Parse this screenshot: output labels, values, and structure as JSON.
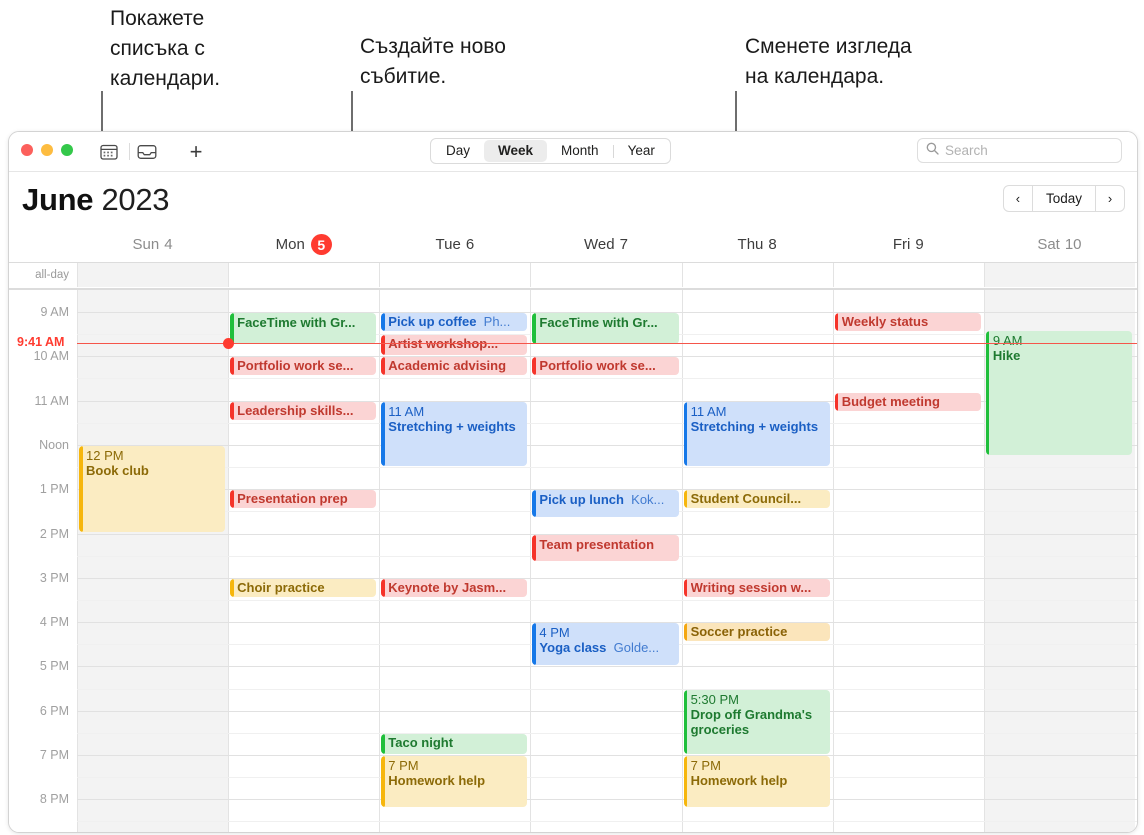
{
  "callouts": [
    {
      "text": "Покажете\nсписъка с\nкалендари."
    },
    {
      "text": "Създайте ново\nсъбитие."
    },
    {
      "text": "Сменете изгледа\nна календара."
    }
  ],
  "toolbar": {
    "calendars_icon": "calendar-list-icon",
    "inbox_icon": "inbox-icon",
    "add_label": "+",
    "views": [
      {
        "label": "Day",
        "active": false
      },
      {
        "label": "Week",
        "active": true
      },
      {
        "label": "Month",
        "active": false
      },
      {
        "label": "Year",
        "active": false
      }
    ],
    "search": {
      "placeholder": "Search",
      "value": "",
      "icon": "search-icon"
    }
  },
  "header": {
    "month": "June",
    "year": "2023",
    "prev_label": "‹",
    "today_label": "Today",
    "next_label": "›"
  },
  "grid": {
    "allday_label": "all-day",
    "now": {
      "label": "9:41 AM",
      "hour": 9.69
    },
    "hours": [
      {
        "label": "9 AM",
        "h": 9
      },
      {
        "label": "10 AM",
        "h": 10
      },
      {
        "label": "11 AM",
        "h": 11
      },
      {
        "label": "Noon",
        "h": 12
      },
      {
        "label": "1 PM",
        "h": 13
      },
      {
        "label": "2 PM",
        "h": 14
      },
      {
        "label": "3 PM",
        "h": 15
      },
      {
        "label": "4 PM",
        "h": 16
      },
      {
        "label": "5 PM",
        "h": 17
      },
      {
        "label": "6 PM",
        "h": 18
      },
      {
        "label": "7 PM",
        "h": 19
      },
      {
        "label": "8 PM",
        "h": 20
      }
    ],
    "days": [
      {
        "name": "Sun",
        "num": "4",
        "today": false,
        "weekend": true
      },
      {
        "name": "Mon",
        "num": "5",
        "today": true,
        "weekend": false
      },
      {
        "name": "Tue",
        "num": "6",
        "today": false,
        "weekend": false
      },
      {
        "name": "Wed",
        "num": "7",
        "today": false,
        "weekend": false
      },
      {
        "name": "Thu",
        "num": "8",
        "today": false,
        "weekend": false
      },
      {
        "name": "Fri",
        "num": "9",
        "today": false,
        "weekend": false
      },
      {
        "name": "Sat",
        "num": "10",
        "today": false,
        "weekend": true
      }
    ],
    "events": [
      {
        "day": 0,
        "start": 12,
        "end": 14,
        "title": "Book club",
        "time": "12 PM",
        "loc": "",
        "color": "yellow",
        "show_time": true
      },
      {
        "day": 1,
        "start": 9,
        "end": 9.75,
        "title": "FaceTime with Gr...",
        "time": "",
        "loc": "",
        "color": "green",
        "show_time": false
      },
      {
        "day": 1,
        "start": 10,
        "end": 10.45,
        "title": "Portfolio work se...",
        "time": "",
        "loc": "",
        "color": "red",
        "show_time": false
      },
      {
        "day": 1,
        "start": 11,
        "end": 11.45,
        "title": "Leadership skills...",
        "time": "",
        "loc": "",
        "color": "red",
        "show_time": false
      },
      {
        "day": 1,
        "start": 13,
        "end": 13.45,
        "title": "Presentation prep",
        "time": "",
        "loc": "",
        "color": "red",
        "show_time": false
      },
      {
        "day": 1,
        "start": 15,
        "end": 15.45,
        "title": "Choir practice",
        "time": "",
        "loc": "",
        "color": "yellow",
        "show_time": false
      },
      {
        "day": 2,
        "start": 9,
        "end": 9.45,
        "title": "Pick up coffee",
        "time": "",
        "loc": "Ph...",
        "color": "blue",
        "show_time": false
      },
      {
        "day": 2,
        "start": 9.5,
        "end": 10,
        "title": "Artist workshop...",
        "time": "",
        "loc": "",
        "color": "red",
        "show_time": false
      },
      {
        "day": 2,
        "start": 10,
        "end": 10.45,
        "title": "Academic advising",
        "time": "",
        "loc": "",
        "color": "red",
        "show_time": false
      },
      {
        "day": 2,
        "start": 11,
        "end": 12.5,
        "title": "Stretching + weights",
        "time": "11 AM",
        "loc": "",
        "color": "blue",
        "show_time": true
      },
      {
        "day": 2,
        "start": 15,
        "end": 15.45,
        "title": "Keynote by Jasm...",
        "time": "",
        "loc": "",
        "color": "red",
        "show_time": false
      },
      {
        "day": 2,
        "start": 18.5,
        "end": 19,
        "title": "Taco night",
        "time": "",
        "loc": "",
        "color": "green",
        "show_time": false
      },
      {
        "day": 2,
        "start": 19,
        "end": 20.2,
        "title": "Homework help",
        "time": "7 PM",
        "loc": "",
        "color": "yellow",
        "show_time": true
      },
      {
        "day": 3,
        "start": 9,
        "end": 9.75,
        "title": "FaceTime with Gr...",
        "time": "",
        "loc": "",
        "color": "green",
        "show_time": false
      },
      {
        "day": 3,
        "start": 10,
        "end": 10.45,
        "title": "Portfolio work se...",
        "time": "",
        "loc": "",
        "color": "red",
        "show_time": false
      },
      {
        "day": 3,
        "start": 13,
        "end": 13.65,
        "title": "Pick up lunch",
        "time": "",
        "loc": "Kok...",
        "color": "blue",
        "show_time": false
      },
      {
        "day": 3,
        "start": 14,
        "end": 14.65,
        "title": "Team presentation",
        "time": "",
        "loc": "",
        "color": "red",
        "show_time": false
      },
      {
        "day": 3,
        "start": 16,
        "end": 17,
        "title": "Yoga class",
        "time": "4 PM",
        "loc": "Golde...",
        "color": "blue",
        "show_time": true
      },
      {
        "day": 4,
        "start": 11,
        "end": 12.5,
        "title": "Stretching + weights",
        "time": "11 AM",
        "loc": "",
        "color": "blue",
        "show_time": true
      },
      {
        "day": 4,
        "start": 13,
        "end": 13.45,
        "title": "Student Council...",
        "time": "",
        "loc": "",
        "color": "yellow",
        "show_time": false
      },
      {
        "day": 4,
        "start": 15,
        "end": 15.45,
        "title": "Writing session w...",
        "time": "",
        "loc": "",
        "color": "red",
        "show_time": false
      },
      {
        "day": 4,
        "start": 16,
        "end": 16.45,
        "title": "Soccer practice",
        "time": "",
        "loc": "",
        "color": "orange",
        "show_time": false
      },
      {
        "day": 4,
        "start": 17.5,
        "end": 19,
        "title": "Drop off Grandma's groceries",
        "time": "5:30 PM",
        "loc": "",
        "color": "green",
        "show_time": true
      },
      {
        "day": 4,
        "start": 19,
        "end": 20.2,
        "title": "Homework help",
        "time": "7 PM",
        "loc": "",
        "color": "yellow",
        "show_time": true
      },
      {
        "day": 5,
        "start": 9,
        "end": 9.45,
        "title": "Weekly status",
        "time": "",
        "loc": "",
        "color": "red",
        "show_time": false
      },
      {
        "day": 5,
        "start": 10.8,
        "end": 11.25,
        "title": "Budget meeting",
        "time": "",
        "loc": "",
        "color": "red",
        "show_time": false
      },
      {
        "day": 6,
        "start": 9.4,
        "end": 12.25,
        "title": "Hike",
        "time": "9 AM",
        "loc": "",
        "color": "green",
        "show_time": true
      }
    ]
  },
  "colors": {
    "accent_red": "#ff3b30",
    "event_red": "#f5342a",
    "event_green": "#1fbf3b",
    "event_blue": "#1678e8",
    "event_yellow": "#f6b60c",
    "event_orange": "#f4a712"
  }
}
